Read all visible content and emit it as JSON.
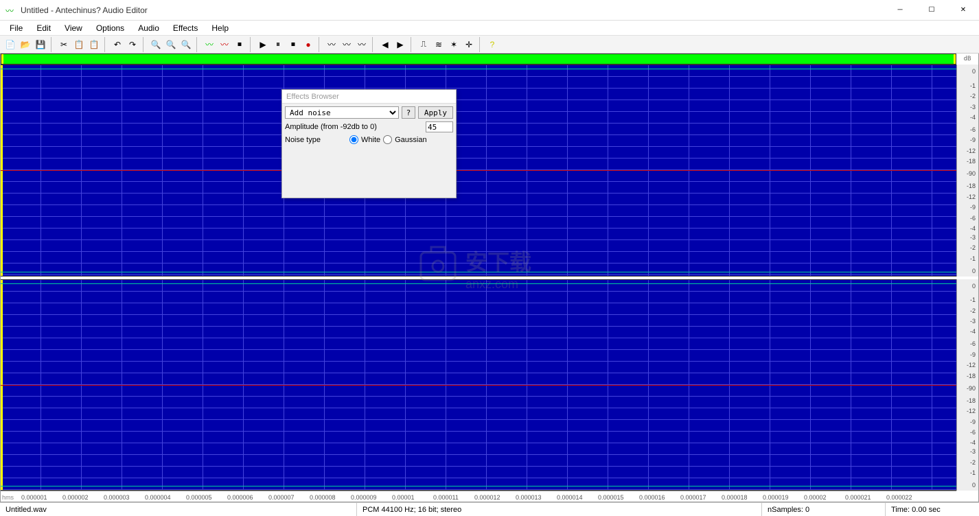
{
  "window": {
    "title": "Untitled - Antechinus? Audio Editor"
  },
  "menu": {
    "items": [
      "File",
      "Edit",
      "View",
      "Options",
      "Audio",
      "Effects",
      "Help"
    ]
  },
  "toolbar": {
    "icons": [
      {
        "name": "new-icon",
        "g": "📄"
      },
      {
        "name": "open-icon",
        "g": "📂"
      },
      {
        "name": "save-icon",
        "g": "💾"
      },
      {
        "sep": true
      },
      {
        "name": "cut-icon",
        "g": "✂"
      },
      {
        "name": "copy-icon",
        "g": "📋"
      },
      {
        "name": "paste-icon",
        "g": "📋"
      },
      {
        "sep": true
      },
      {
        "name": "undo-icon",
        "g": "↶"
      },
      {
        "name": "redo-icon",
        "g": "↷"
      },
      {
        "sep": true
      },
      {
        "name": "zoom-in-icon",
        "g": "🔍"
      },
      {
        "name": "zoom-out-icon",
        "g": "🔍"
      },
      {
        "name": "zoom-fit-icon",
        "g": "🔍"
      },
      {
        "sep": true
      },
      {
        "name": "wave-green-icon",
        "g": "〰",
        "c": "#0c0"
      },
      {
        "name": "wave-red-icon",
        "g": "〰",
        "c": "#c00"
      },
      {
        "name": "stop2-icon",
        "g": "⏹"
      },
      {
        "sep": true
      },
      {
        "name": "play-icon",
        "g": "▶"
      },
      {
        "name": "pause-icon",
        "g": "⏸"
      },
      {
        "name": "stop-icon",
        "g": "⏹"
      },
      {
        "name": "record-icon",
        "g": "●",
        "c": "#c00"
      },
      {
        "sep": true
      },
      {
        "name": "fx1-icon",
        "g": "〰"
      },
      {
        "name": "fx2-icon",
        "g": "〰"
      },
      {
        "name": "fx3-icon",
        "g": "〰"
      },
      {
        "sep": true
      },
      {
        "name": "fade-in-icon",
        "g": "◀"
      },
      {
        "name": "fade-out-icon",
        "g": "▶"
      },
      {
        "sep": true
      },
      {
        "name": "eq-icon",
        "g": "⎍"
      },
      {
        "name": "filter-icon",
        "g": "≋"
      },
      {
        "name": "mix-icon",
        "g": "✶"
      },
      {
        "name": "marker-icon",
        "g": "✛"
      },
      {
        "sep": true
      },
      {
        "name": "help-icon",
        "g": "?",
        "c": "#cc0"
      }
    ]
  },
  "dbHeader": "dB",
  "dbScale": {
    "upper": [
      {
        "v": "0",
        "p": 2
      },
      {
        "v": "-1",
        "p": 10
      },
      {
        "v": "-2",
        "p": 16
      },
      {
        "v": "-3",
        "p": 22
      },
      {
        "v": "-4",
        "p": 28
      },
      {
        "v": "-6",
        "p": 35
      },
      {
        "v": "-9",
        "p": 41
      },
      {
        "v": "-12",
        "p": 47
      },
      {
        "v": "-18",
        "p": 53
      },
      {
        "v": "-90",
        "p": 60
      },
      {
        "v": "-18",
        "p": 67
      },
      {
        "v": "-12",
        "p": 73
      },
      {
        "v": "-9",
        "p": 79
      },
      {
        "v": "-6",
        "p": 85
      },
      {
        "v": "-4",
        "p": 91
      },
      {
        "v": "-3",
        "p": 96
      },
      {
        "v": "-2",
        "p": 102
      },
      {
        "v": "-1",
        "p": 108
      },
      {
        "v": "0",
        "p": 115
      }
    ],
    "lower": [
      {
        "v": "-90",
        "p": 60
      }
    ]
  },
  "timeline": {
    "unit": "hms",
    "ticks": [
      "0.000001",
      "0.000002",
      "0.000003",
      "0.000004",
      "0.000005",
      "0.000006",
      "0.000007",
      "0.000008",
      "0.000009",
      "0.00001",
      "0.000011",
      "0.000012",
      "0.000013",
      "0.000014",
      "0.000015",
      "0.000016",
      "0.000017",
      "0.000018",
      "0.000019",
      "0.00002",
      "0.000021",
      "0.000022"
    ]
  },
  "effects": {
    "title": "Effects Browser",
    "selected": "Add noise",
    "helpLabel": "?",
    "applyLabel": "Apply",
    "amplitudeLabel": "Amplitude (from -92db to 0)",
    "amplitudeValue": "45",
    "noiseTypeLabel": "Noise type",
    "opt1": "White",
    "opt2": "Gaussian"
  },
  "status": {
    "file": "Untitled.wav",
    "format": "PCM 44100 Hz; 16 bit; stereo",
    "samples": "nSamples: 0",
    "time": "Time: 0.00 sec"
  },
  "watermark": {
    "text1": "安下载",
    "text2": "anxz.com"
  }
}
